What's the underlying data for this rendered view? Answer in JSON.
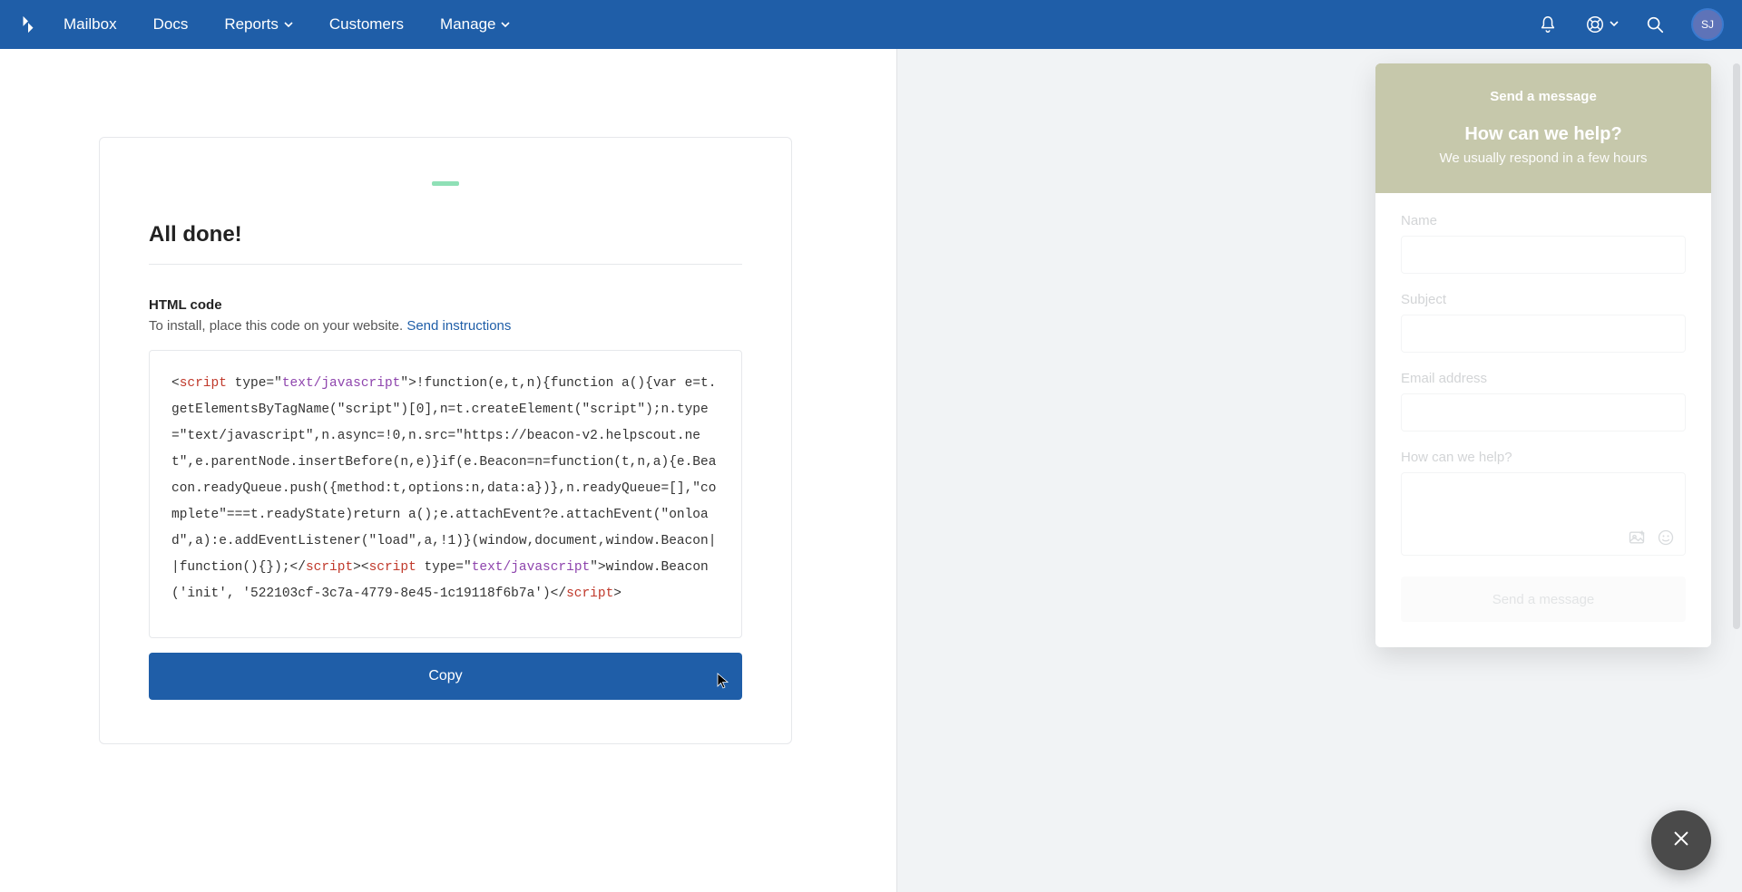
{
  "nav": {
    "items": [
      {
        "label": "Mailbox",
        "caret": false
      },
      {
        "label": "Docs",
        "caret": false
      },
      {
        "label": "Reports",
        "caret": true
      },
      {
        "label": "Customers",
        "caret": false
      },
      {
        "label": "Manage",
        "caret": true
      }
    ],
    "avatar_initials": "SJ"
  },
  "card": {
    "heading": "All done!",
    "section_label": "HTML code",
    "section_sub": "To install, place this code on your website. ",
    "send_link": "Send instructions",
    "copy_label": "Copy",
    "code": {
      "open_tag": "script",
      "type_attr": " type=\"",
      "mime": "text/javascript",
      "after_mime": "\">",
      "body1": "!function(e,t,n){function a(){var e=t.getElementsByTagName(\"script\")[0],n=t.createElement(\"script\");n.type=\"text/javascript\",n.async=!0,n.src=\"https://beacon-v2.helpscout.net\",e.parentNode.insertBefore(n,e)}if(e.Beacon=n=function(t,n,a){e.Beacon.readyQueue.push({method:t,options:n,data:a})},n.readyQueue=[],\"complete\"===t.readyState)return a();e.attachEvent?e.attachEvent(\"onload\",a):e.addEventListener(\"load\",a,!1)}(window,document,window.Beacon||function(){});",
      "close_tag": "script",
      "open2_tag": "script",
      "mime2": "text/javascript",
      "body2": "window.Beacon('init', '522103cf-3c7a-4779-8e45-1c19118f6b7a')",
      "close2_tag": "script"
    }
  },
  "chat": {
    "top_small": "Send a message",
    "heading": "How can we help?",
    "subheading": "We usually respond in a few hours",
    "fields": {
      "name_label": "Name",
      "subject_label": "Subject",
      "email_label": "Email address",
      "help_label": "How can we help?"
    },
    "send_button": "Send a message"
  }
}
